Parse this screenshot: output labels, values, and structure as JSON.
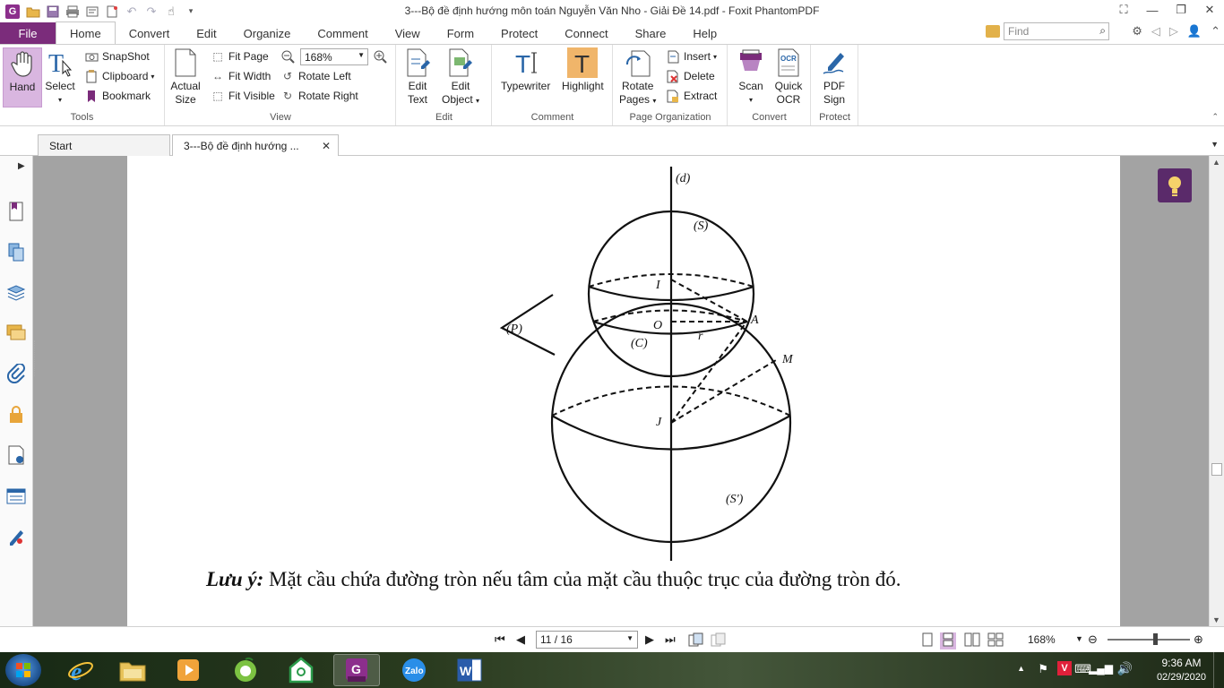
{
  "app": {
    "window_title": "3---Bộ đề định hướng môn toán Nguyễn Văn Nho - Giải Đề 14.pdf - Foxit PhantomPDF",
    "icon_letter": "G"
  },
  "ribbon_tabs": [
    "File",
    "Home",
    "Convert",
    "Edit",
    "Organize",
    "Comment",
    "View",
    "Form",
    "Protect",
    "Connect",
    "Share",
    "Help"
  ],
  "active_tab": "Home",
  "search": {
    "placeholder": "Find"
  },
  "groups": {
    "tools": {
      "label": "Tools",
      "hand": "Hand",
      "select": "Select",
      "snapshot": "SnapShot",
      "clipboard": "Clipboard",
      "bookmark": "Bookmark"
    },
    "view": {
      "label": "View",
      "actual_size_1": "Actual",
      "actual_size_2": "Size",
      "fit_page": "Fit Page",
      "fit_width": "Fit Width",
      "fit_visible": "Fit Visible",
      "zoom": "168%",
      "rotate_left": "Rotate Left",
      "rotate_right": "Rotate Right"
    },
    "edit": {
      "label": "Edit",
      "edit_text_1": "Edit",
      "edit_text_2": "Text",
      "edit_object_1": "Edit",
      "edit_object_2": "Object"
    },
    "comment": {
      "label": "Comment",
      "typewriter": "Typewriter",
      "highlight": "Highlight"
    },
    "page_org": {
      "label": "Page Organization",
      "rotate_pages_1": "Rotate",
      "rotate_pages_2": "Pages",
      "insert": "Insert",
      "delete": "Delete",
      "extract": "Extract"
    },
    "convert": {
      "label": "Convert",
      "scan": "Scan",
      "quick_ocr_1": "Quick",
      "quick_ocr_2": "OCR"
    },
    "protect": {
      "label": "Protect",
      "pdf_sign_1": "PDF",
      "pdf_sign_2": "Sign"
    }
  },
  "doc_tabs": [
    {
      "label": "Start"
    },
    {
      "label": "3---Bộ đề định hướng ..."
    }
  ],
  "figure": {
    "d": "(d)",
    "s": "(S)",
    "s_prime": "(S')",
    "p": "(P)",
    "c": "(C)",
    "i": "I",
    "o": "O",
    "a": "A",
    "r": "r",
    "m": "M",
    "j": "J"
  },
  "note": {
    "prefix": "Lưu ý:",
    "text": " Mặt cầu chứa đường tròn nếu tâm của mặt cầu thuộc trục của đường tròn đó."
  },
  "statusbar": {
    "page": "11 / 16",
    "zoom": "168%"
  },
  "clock": {
    "time": "9:36 AM",
    "date": "02/29/2020"
  },
  "colors": {
    "accent": "#7b2c7b",
    "hand_active": "#d9b6e0",
    "doc_background": "#a3a3a3"
  }
}
